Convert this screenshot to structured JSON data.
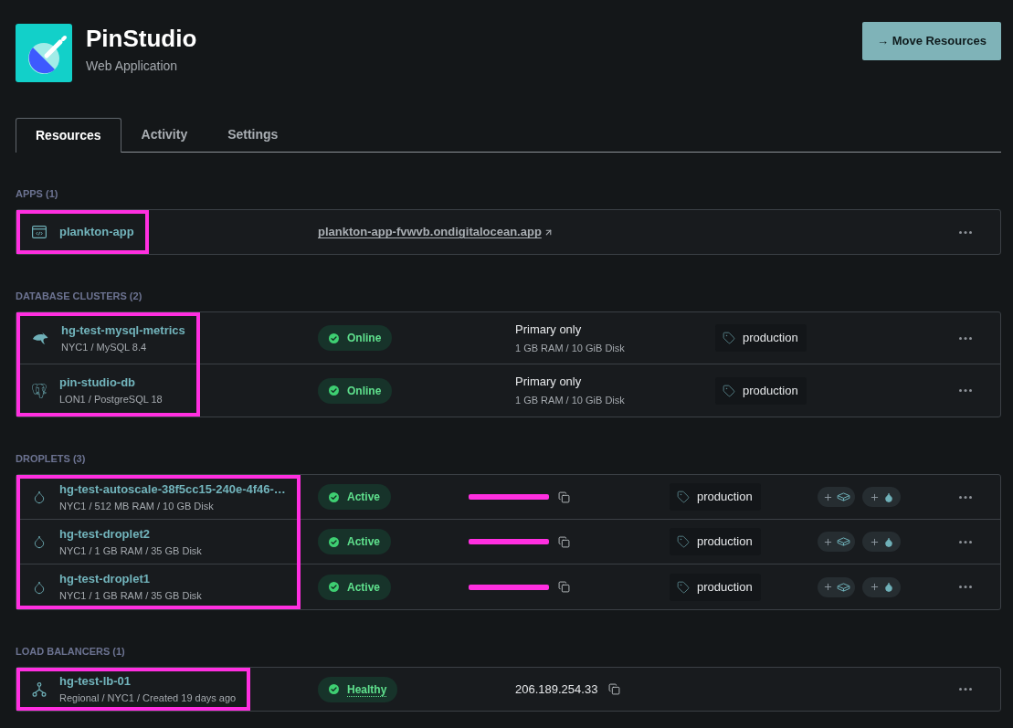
{
  "header": {
    "title": "PinStudio",
    "subtitle": "Web Application",
    "action": "→ Move Resources"
  },
  "tabs": [
    {
      "label": "Resources",
      "selected": true
    },
    {
      "label": "Activity",
      "selected": false
    },
    {
      "label": "Settings",
      "selected": false
    }
  ],
  "sections": [
    {
      "kind": "apps",
      "heading": "APPS (1)",
      "highlighted": true,
      "rows": [
        {
          "name": "plankton-app",
          "url": "plankton-app-fvwvb.ondigitalocean.app"
        }
      ]
    },
    {
      "kind": "databases",
      "heading": "DATABASE CLUSTERS (2)",
      "highlighted": true,
      "rows": [
        {
          "kind": "mysql",
          "name": "hg-test-mysql-metrics",
          "details": "NYC1 / MySQL 8.4",
          "status": "Online",
          "plan": "Primary only",
          "size": "1 GB RAM / 10 GiB Disk",
          "tag": "production"
        },
        {
          "kind": "postgresql",
          "name": "pin-studio-db",
          "details": "LON1 / PostgreSQL 18",
          "status": "Online",
          "plan": "Primary only",
          "size": "1 GB RAM / 10 GiB Disk",
          "tag": "production"
        }
      ]
    },
    {
      "kind": "droplets",
      "heading": "DROPLETS (3)",
      "highlighted": true,
      "rows": [
        {
          "name": "hg-test-autoscale-38f5cc15-240e-4f46-…",
          "details": "NYC1 / 512 MB RAM / 10 GB Disk",
          "status": "Active",
          "ip_redacted": true,
          "tag": "production"
        },
        {
          "name": "hg-test-droplet2",
          "details": "NYC1 / 1 GB RAM / 35 GB Disk",
          "status": "Active",
          "ip_redacted": true,
          "tag": "production"
        },
        {
          "name": "hg-test-droplet1",
          "details": "NYC1 / 1 GB RAM / 35 GB Disk",
          "status": "Active",
          "ip_redacted": true,
          "tag": "production"
        }
      ]
    },
    {
      "kind": "load_balancers",
      "heading": "LOAD BALANCERS (1)",
      "highlighted": true,
      "rows": [
        {
          "name": "hg-test-lb-01",
          "details": "Regional / NYC1 / Created 19 days ago",
          "status": "Healthy",
          "ip": "206.189.254.33"
        }
      ]
    }
  ]
}
